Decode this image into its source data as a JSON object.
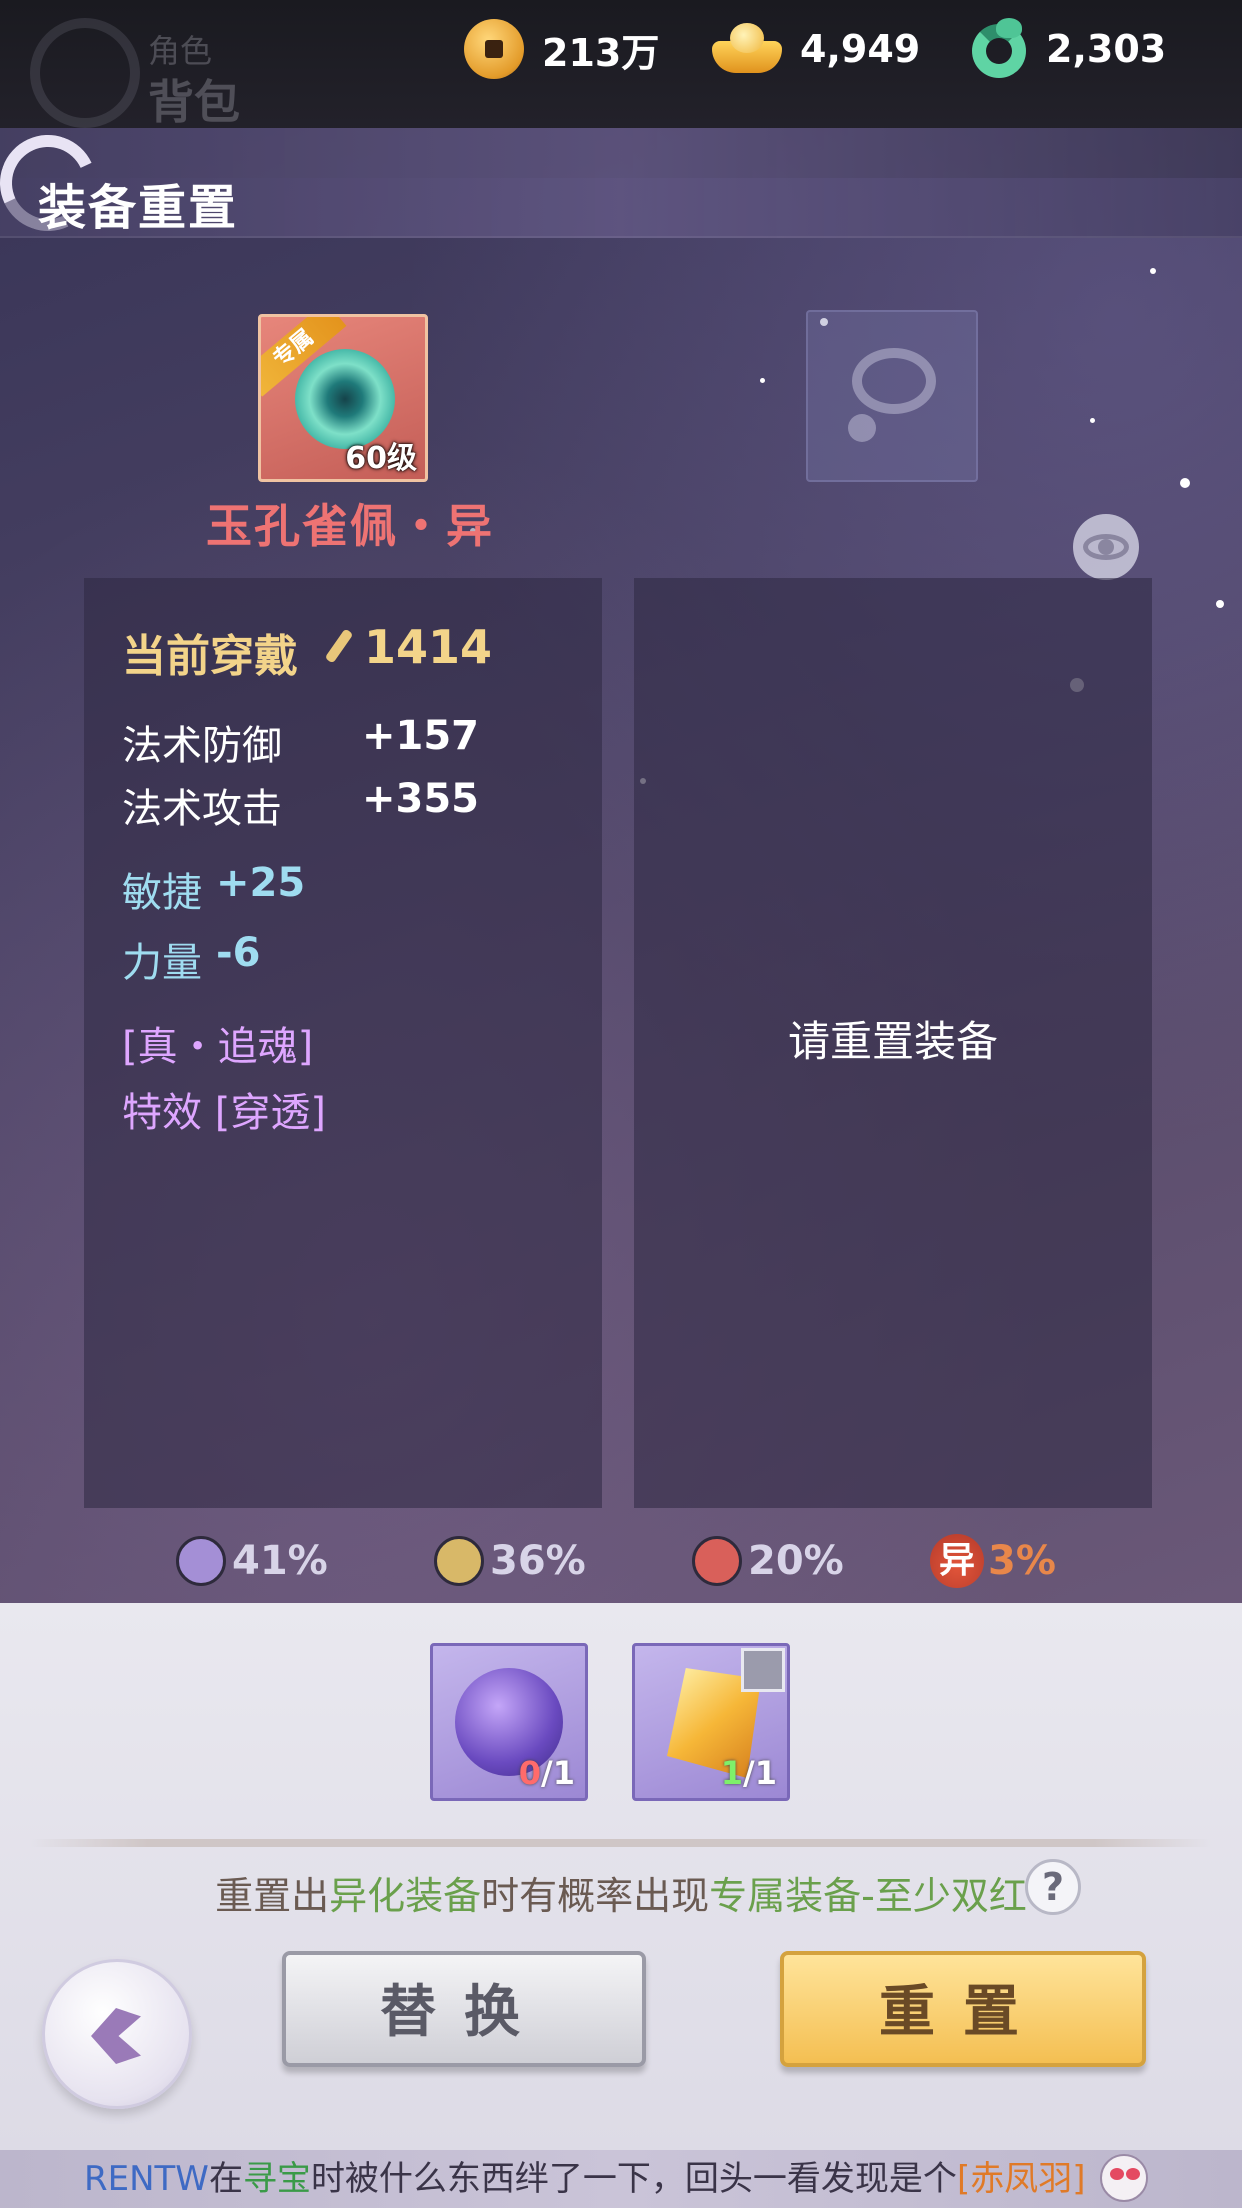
{
  "nav": {
    "tab_top": "角色",
    "tab_bottom": "背包"
  },
  "currencies": [
    {
      "icon": "copper-coin-icon",
      "value": "213万"
    },
    {
      "icon": "gold-ingot-icon",
      "value": "4,949"
    },
    {
      "icon": "jade-dragon-icon",
      "value": "2,303"
    }
  ],
  "page": {
    "title": "装备重置"
  },
  "equipment": {
    "badge": "专属",
    "level": "60级",
    "name": "玉孔雀佩・异"
  },
  "current": {
    "title": "当前穿戴",
    "score": "1414",
    "base_stats": [
      {
        "name": "法术防御",
        "value": "+157"
      },
      {
        "name": "法术攻击",
        "value": "+355"
      }
    ],
    "bonus_stats": [
      {
        "name": "敏捷",
        "value": "+25"
      },
      {
        "name": "力量",
        "value": "-6"
      }
    ],
    "effects": [
      "[真・追魂]",
      "特效 [穿透]"
    ]
  },
  "result": {
    "placeholder": "请重置装备"
  },
  "odds": [
    {
      "color": "#a48fd6",
      "value": "41%"
    },
    {
      "color": "#d8b868",
      "value": "36%"
    },
    {
      "color": "#d9605a",
      "value": "20%"
    },
    {
      "label": "异",
      "value": "3%",
      "color": "#e8874a"
    }
  ],
  "materials": [
    {
      "icon": "purple-orb-icon",
      "have": "0",
      "need": "/1"
    },
    {
      "icon": "gold-crystal-icon",
      "have": "1",
      "need": "/1"
    }
  ],
  "tip": {
    "p1": "重置出",
    "p2": "异化装备",
    "p3": "时有概率出现",
    "p4": "专属装备-至少双红"
  },
  "buttons": {
    "replace": "替换",
    "reset": "重置",
    "help": "?"
  },
  "ticker": {
    "player": "RENTW",
    "p1": "在",
    "place": "寻宝",
    "p2": "时被什么东西绊了一下，回头一看发现是个",
    "item": "[赤凤羽]"
  }
}
